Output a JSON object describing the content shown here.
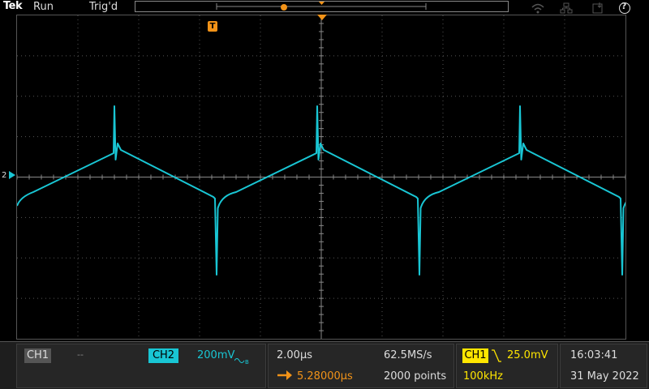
{
  "top": {
    "brand": "Tek",
    "run_state": "Run",
    "trigger_state": "Trig'd",
    "help": "?"
  },
  "display": {
    "channel_marker": "2",
    "trigger_marker": "T",
    "waveform_color": "#19c6d4",
    "trigger_color": "#f29318"
  },
  "channels": {
    "ch1": {
      "label": "CH1",
      "status": "--"
    },
    "ch2": {
      "label": "CH2",
      "scale": "200mV"
    }
  },
  "horizontal": {
    "scale": "2.00µs",
    "position": "5.28000µs",
    "sample_rate": "62.5MS/s",
    "record_length": "2000 points"
  },
  "trigger": {
    "source": "CH1",
    "level": "25.0mV",
    "frequency": "100kHz",
    "slope": "falling"
  },
  "clock": {
    "time": "16:03:41",
    "date": "31 May 2022"
  }
}
